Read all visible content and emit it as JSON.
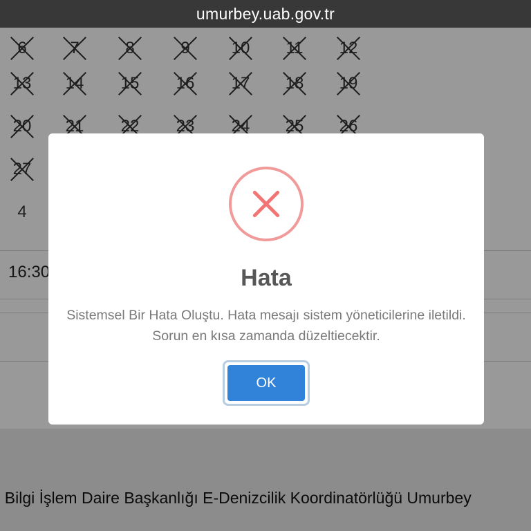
{
  "browser": {
    "url": "umurbey.uab.gov.tr"
  },
  "calendar": {
    "rows": [
      {
        "days": [
          {
            "label": "6",
            "crossed": true
          },
          {
            "label": "7",
            "crossed": true
          },
          {
            "label": "8",
            "crossed": true
          },
          {
            "label": "9",
            "crossed": true
          },
          {
            "label": "10",
            "crossed": true
          },
          {
            "label": "11",
            "crossed": true
          },
          {
            "label": "12",
            "crossed": true
          }
        ]
      },
      {
        "days": [
          {
            "label": "13",
            "crossed": true
          },
          {
            "label": "14",
            "crossed": true
          },
          {
            "label": "15",
            "crossed": true
          },
          {
            "label": "16",
            "crossed": true
          },
          {
            "label": "17",
            "crossed": true
          },
          {
            "label": "18",
            "crossed": true
          },
          {
            "label": "19",
            "crossed": true
          }
        ]
      },
      {
        "days": [
          {
            "label": "20",
            "crossed": true
          },
          {
            "label": "21",
            "crossed": true
          },
          {
            "label": "22",
            "crossed": true
          },
          {
            "label": "23",
            "crossed": true
          },
          {
            "label": "24",
            "crossed": true
          },
          {
            "label": "25",
            "crossed": true
          },
          {
            "label": "26",
            "crossed": true
          }
        ]
      },
      {
        "days": [
          {
            "label": "27",
            "crossed": true
          }
        ]
      },
      {
        "days": [
          {
            "label": "4",
            "crossed": false
          }
        ]
      }
    ]
  },
  "time_slot": {
    "label": "16:30"
  },
  "footer": {
    "text": "ı Bilgi İşlem Daire Başkanlığı E-Denizcilik Koordinatörlüğü Umurbey"
  },
  "modal": {
    "icon": "error-x-icon",
    "title": "Hata",
    "message": "Sistemsel Bir Hata Oluştu. Hata mesajı sistem yöneticilerine iletildi. Sorun en kısa zamanda düzeltiecektir.",
    "ok_label": "OK",
    "colors": {
      "error": "#f27474",
      "button": "#3083d8"
    }
  }
}
